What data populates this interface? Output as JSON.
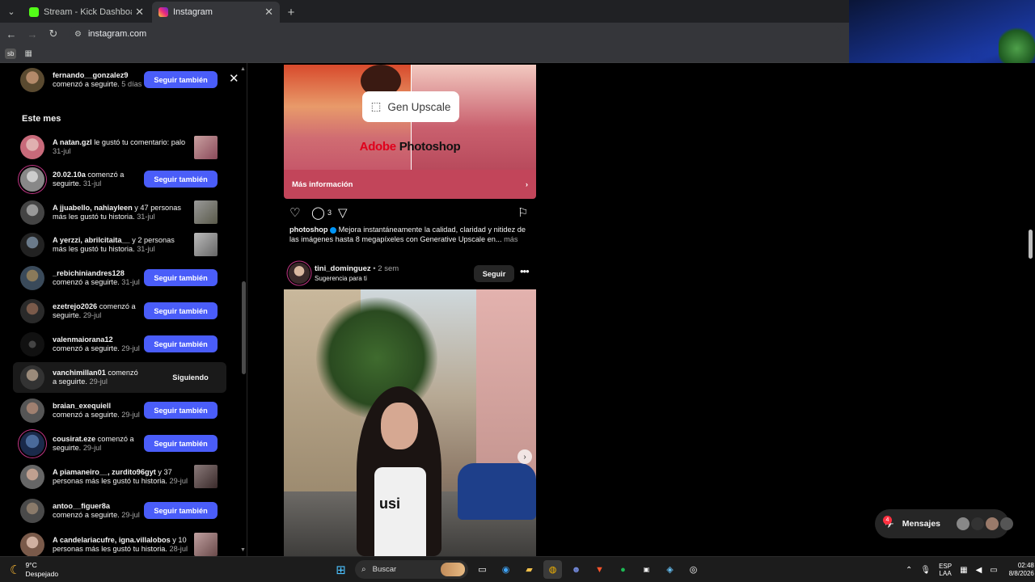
{
  "browser": {
    "tabs": [
      {
        "label": "Stream - Kick Dashboard",
        "favicon_color": "#53fc18",
        "active": false
      },
      {
        "label": "Instagram",
        "favicon_color": "#e1306c",
        "active": true
      }
    ],
    "new_tab_icon": "plus-icon",
    "url": "instagram.com",
    "bookmark_item": "sb"
  },
  "notifications": {
    "section_title": "Este mes",
    "rows": [
      {
        "user": "fernando__gonzalez9",
        "text": " comenzó a seguirte.",
        "time": "5 días",
        "action": "Seguir también"
      },
      {
        "user": "A natan.gzl",
        "text": " le gustó tu comentario: palo",
        "time": "31-jul",
        "action": ""
      },
      {
        "user": "20.02.10a",
        "text": " comenzó a seguirte.",
        "time": "31-jul",
        "action": "Seguir también"
      },
      {
        "user": "A jjuabello, nahiayleen",
        "text": " y 47 personas más les gustó tu historia.",
        "time": "31-jul",
        "action": ""
      },
      {
        "user": "A yerzzi, abrilcitaita__",
        "text": " y 2 personas más les gustó tu historia.",
        "time": "31-jul",
        "action": ""
      },
      {
        "user": "_rebichiniandres128",
        "text": " comenzó a seguirte.",
        "time": "31-jul",
        "action": "Seguir también"
      },
      {
        "user": "ezetrejo2026",
        "text": " comenzó a seguirte.",
        "time": "29-jul",
        "action": "Seguir también"
      },
      {
        "user": "valenmaiorana12",
        "text": " comenzó a seguirte.",
        "time": "29-jul",
        "action": "Seguir también"
      },
      {
        "user": "vanchimillan01",
        "text": " comenzó a seguirte.",
        "time": "29-jul",
        "action": "Siguiendo"
      },
      {
        "user": "braian_exequiell",
        "text": " comenzó a seguirte.",
        "time": "29-jul",
        "action": "Seguir también"
      },
      {
        "user": "cousirat.eze",
        "text": " comenzó a seguirte.",
        "time": "29-jul",
        "action": "Seguir también"
      },
      {
        "user": "A piamaneiro__, zurdito96gyt",
        "text": " y 37 personas más les gustó tu historia.",
        "time": "29-jul",
        "action": ""
      },
      {
        "user": "antoo__figuer8a",
        "text": " comenzó a seguirte.",
        "time": "29-jul",
        "action": "Seguir también"
      },
      {
        "user": "A candelariacufre, igna.villalobos",
        "text": " y 10 personas más les gustó tu historia.",
        "time": "28-jul",
        "action": ""
      }
    ]
  },
  "ad": {
    "overlay_button": "Gen Upscale",
    "brand_part1": "Adobe",
    "brand_part2": " Photoshop",
    "cta": "Más información",
    "comment_count": "3",
    "caption_user": "photoshop",
    "caption_text": " Mejora instantáneamente la calidad, claridad y nitidez de las imágenes hasta 8 megapíxeles con Generative Upscale en...",
    "caption_more": " más"
  },
  "post": {
    "user": "tini_dominguez",
    "time": " • 2 sem",
    "subtitle": "Sugerencia para ti",
    "follow_label": "Seguir",
    "shirt_text": "usi"
  },
  "messages": {
    "label": "Mensajes",
    "badge": "4"
  },
  "taskbar": {
    "temp": "9°C",
    "weather": "Despejado",
    "search": "Buscar",
    "lang1": "ESP",
    "lang2": "LAA",
    "time": "02:48",
    "date": "8/8/2026"
  },
  "colors": {
    "follow_button": "#4a5df9",
    "page_bg": "#000000",
    "ad_cta": "#c2455a"
  }
}
